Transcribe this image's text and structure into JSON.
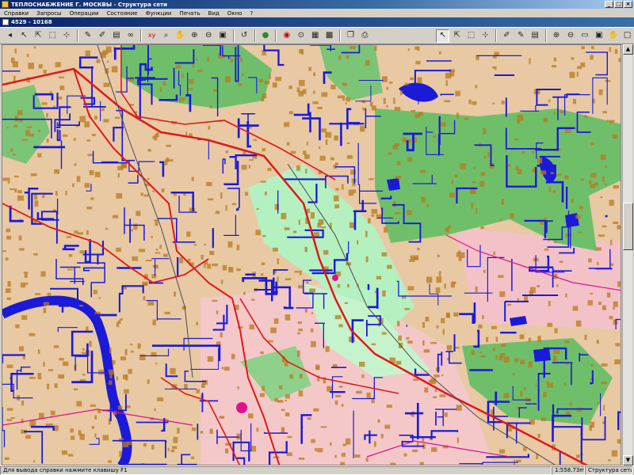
{
  "window": {
    "title": "ТЕПЛОСНАБЖЕНИЕ Г. МОСКВЫ - Структура сети",
    "minimize": "_",
    "maximize": "□",
    "close": "×"
  },
  "menu": [
    "Справки",
    "Запросы",
    "Операции",
    "Состояние",
    "Функции",
    "Печать",
    "Вид",
    "Окно",
    "?"
  ],
  "document": {
    "title": "4529 - 10168"
  },
  "toolbar": {
    "left_icons": [
      "cursor-icon",
      "select-icon",
      "select-area-icon",
      "node-icon",
      "edit-icon",
      "pen-icon",
      "layers-icon",
      "binoculars-icon",
      "coordinates-icon",
      "zoom-icon",
      "pan-icon",
      "zoom-in-icon",
      "zoom-out-icon",
      "refresh-icon",
      "traffic-light-icon",
      "target-icon",
      "point-icon",
      "picture-icon",
      "copy-icon",
      "print-icon"
    ],
    "right_icons": [
      "select-icon",
      "select-area-icon",
      "node-icon",
      "edit-icon",
      "pen-icon",
      "layers-icon",
      "zoom-in-icon",
      "zoom-out-icon",
      "zoom-window-icon",
      "zoom-full-icon",
      "pan-icon",
      "restore-icon"
    ]
  },
  "map": {
    "colors": {
      "background": "#e8c9a4",
      "green_zone": "#6fbf6a",
      "light_green": "#b5f0c0",
      "pink_zone": "#f4c8c8",
      "buildings": "#b87a1e",
      "heat_network": "#1a1ad8",
      "main_pipes": "#e01818",
      "water": "#1a1ad8",
      "magenta": "#e0108a"
    }
  },
  "status": {
    "hint": "Для вывода справки нажмите клавишу F1",
    "scale": "1:558.73m",
    "mode": "Структура сети"
  }
}
